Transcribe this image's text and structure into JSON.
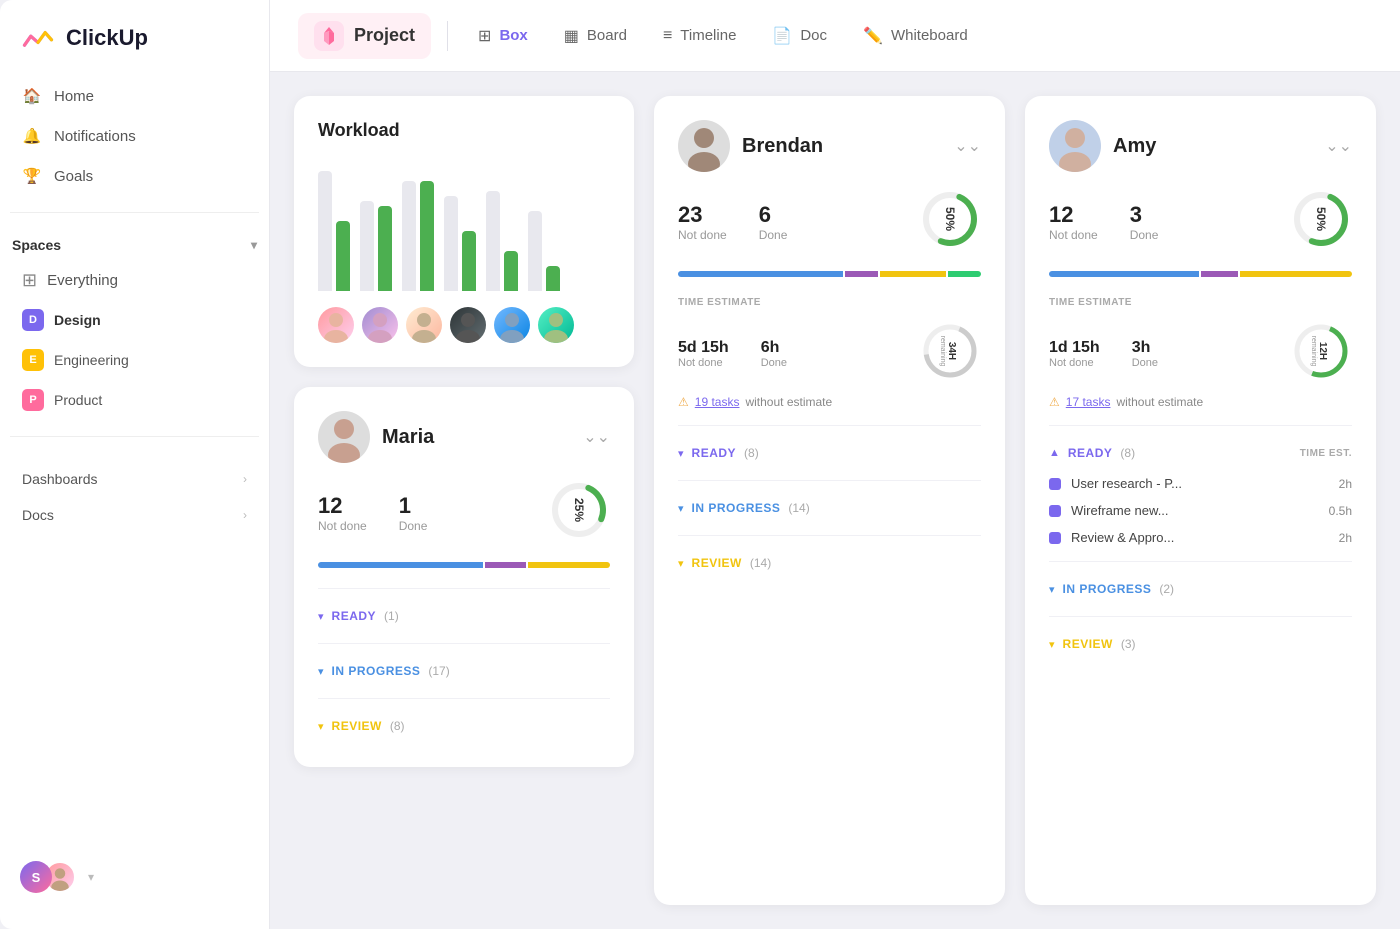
{
  "app": {
    "name": "ClickUp"
  },
  "sidebar": {
    "nav": [
      {
        "id": "home",
        "label": "Home",
        "icon": "🏠"
      },
      {
        "id": "notifications",
        "label": "Notifications",
        "icon": "🔔"
      },
      {
        "id": "goals",
        "label": "Goals",
        "icon": "🏆"
      }
    ],
    "spaces_label": "Spaces",
    "spaces": [
      {
        "id": "everything",
        "label": "Everything",
        "badge": null
      },
      {
        "id": "design",
        "label": "Design",
        "badge": "D",
        "badge_class": "badge-d"
      },
      {
        "id": "engineering",
        "label": "Engineering",
        "badge": "E",
        "badge_class": "badge-e"
      },
      {
        "id": "product",
        "label": "Product",
        "badge": "P",
        "badge_class": "badge-p"
      }
    ],
    "bottom": [
      {
        "id": "dashboards",
        "label": "Dashboards"
      },
      {
        "id": "docs",
        "label": "Docs"
      }
    ]
  },
  "topbar": {
    "project_label": "Project",
    "tabs": [
      {
        "id": "box",
        "label": "Box",
        "icon": "⊞"
      },
      {
        "id": "board",
        "label": "Board",
        "icon": "▦"
      },
      {
        "id": "timeline",
        "label": "Timeline",
        "icon": "≡"
      },
      {
        "id": "doc",
        "label": "Doc",
        "icon": "📄"
      },
      {
        "id": "whiteboard",
        "label": "Whiteboard",
        "icon": "✏️"
      }
    ]
  },
  "workload": {
    "title": "Workload",
    "bars": [
      {
        "gray": 120,
        "green": 70
      },
      {
        "gray": 90,
        "green": 85
      },
      {
        "gray": 110,
        "green": 110
      },
      {
        "gray": 95,
        "green": 60
      },
      {
        "gray": 100,
        "green": 40
      },
      {
        "gray": 80,
        "green": 25
      }
    ]
  },
  "brendan": {
    "name": "Brendan",
    "not_done": "23",
    "not_done_label": "Not done",
    "done": "6",
    "done_label": "Done",
    "progress": "50%",
    "time_estimate_label": "TIME ESTIMATE",
    "time_not_done": "5d 15h",
    "time_not_done_label": "Not done",
    "time_done": "6h",
    "time_done_label": "Done",
    "remaining": "34H",
    "remaining_label": "remaining",
    "warning_prefix": "19 tasks",
    "warning_suffix": " without estimate",
    "statuses": [
      {
        "id": "ready",
        "label": "READY",
        "count": "(8)",
        "color": "ready"
      },
      {
        "id": "in_progress",
        "label": "IN PROGRESS",
        "count": "(14)",
        "color": "progress"
      },
      {
        "id": "review",
        "label": "REVIEW",
        "count": "(14)",
        "color": "review"
      }
    ]
  },
  "amy": {
    "name": "Amy",
    "not_done": "12",
    "not_done_label": "Not done",
    "done": "3",
    "done_label": "Done",
    "progress": "50%",
    "time_estimate_label": "TIME ESTIMATE",
    "time_not_done": "1d 15h",
    "time_not_done_label": "Not done",
    "time_done": "3h",
    "time_done_label": "Done",
    "remaining": "12H",
    "remaining_label": "remaining",
    "warning_prefix": "17 tasks",
    "warning_suffix": " without estimate",
    "statuses_ready_label": "READY",
    "statuses_ready_count": "(8)",
    "time_est_header": "TIME EST.",
    "tasks": [
      {
        "name": "User research - P...",
        "time": "2h"
      },
      {
        "name": "Wireframe new...",
        "time": "0.5h"
      },
      {
        "name": "Review & Appro...",
        "time": "2h"
      }
    ],
    "in_progress_label": "IN PROGRESS",
    "in_progress_count": "(2)",
    "review_label": "REVIEW",
    "review_count": "(3)"
  },
  "maria": {
    "name": "Maria",
    "not_done": "12",
    "not_done_label": "Not done",
    "done": "1",
    "done_label": "Done",
    "progress": "25%",
    "statuses": [
      {
        "id": "ready",
        "label": "READY",
        "count": "(1)",
        "color": "ready"
      },
      {
        "id": "in_progress",
        "label": "IN PROGRESS",
        "count": "(17)",
        "color": "progress"
      },
      {
        "id": "review",
        "label": "REVIEW",
        "count": "(8)",
        "color": "review"
      }
    ]
  }
}
